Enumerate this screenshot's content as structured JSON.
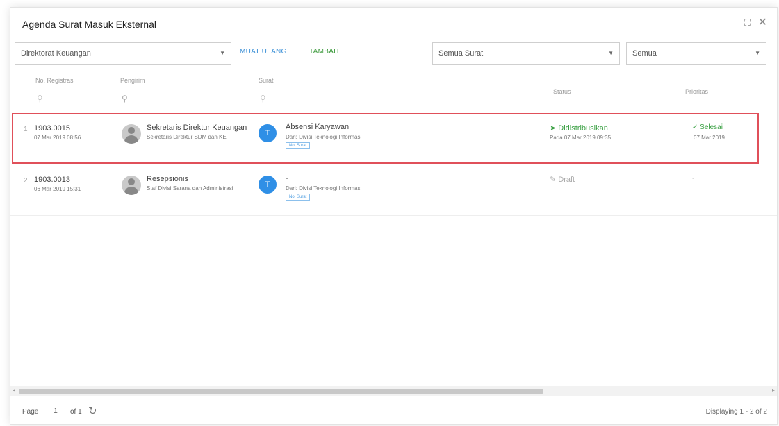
{
  "window": {
    "title": "Agenda Surat Masuk Eksternal",
    "maximize_glyph": "⛶",
    "close_glyph": "✕"
  },
  "toolbar": {
    "directorate_select": "Direktorat Keuangan",
    "reload_label": "MUAT ULANG",
    "add_label": "TAMBAH",
    "letter_filter_select": "Semua Surat",
    "scope_select": "Semua"
  },
  "columns": {
    "no_registrasi": "No. Registrasi",
    "pengirim": "Pengirim",
    "surat": "Surat",
    "status": "Status",
    "prioritas": "Prioritas"
  },
  "rows": [
    {
      "index": "1",
      "reg_no": "1903.0015",
      "reg_date": "07 Mar 2019 08:56",
      "sender_name": "Sekretaris Direktur Keuangan",
      "sender_role": "Sekretaris Direktur SDM dan KE",
      "letter_initial": "T",
      "letter_title": "Absensi Karyawan",
      "letter_from": "Dari: Divisi Teknologi Informasi",
      "letter_tag": "No. Surat",
      "status_icon": "➤",
      "status_label": "Didistribusikan",
      "status_sub": "Pada 07 Mar 2019 09:35",
      "priority_icon": "✓",
      "priority_label": "Selesai",
      "priority_sub": "07 Mar 2019"
    },
    {
      "index": "2",
      "reg_no": "1903.0013",
      "reg_date": "06 Mar 2019 15:31",
      "sender_name": "Resepsionis",
      "sender_role": "Staf Divisi Sarana dan Administrasi",
      "letter_initial": "T",
      "letter_title": "-",
      "letter_from": "Dari: Divisi Teknologi Informasi",
      "letter_tag": "No. Surat",
      "status_icon": "✎",
      "status_label": "Draft",
      "priority_label": "-"
    }
  ],
  "footer": {
    "page_label": "Page",
    "page_value": "1",
    "of_label": "of 1",
    "refresh_glyph": "↻",
    "displaying": "Displaying 1 - 2 of 2"
  },
  "colors": {
    "accent_blue": "#2f8fe6",
    "success_green": "#3aa043",
    "highlight_red": "#e0505a"
  }
}
